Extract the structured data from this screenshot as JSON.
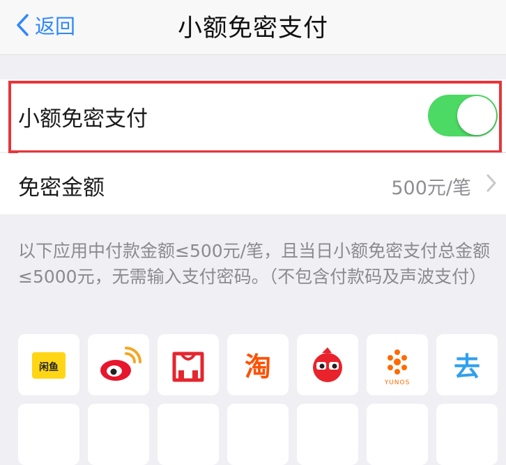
{
  "nav": {
    "back_label": "返回",
    "title": "小额免密支付"
  },
  "toggle_row": {
    "label": "小额免密支付",
    "enabled": true
  },
  "amount_row": {
    "label": "免密金额",
    "value": "500元/笔"
  },
  "description": "以下应用中付款金额≤500元/笔，且当日小额免密支付总金额≤5000元，无需输入支付密码。（不包含付款码及声波支付）",
  "apps": [
    {
      "icon": "xianyu-icon",
      "text": "闲鱼"
    },
    {
      "icon": "weibo-icon"
    },
    {
      "icon": "tmall-icon"
    },
    {
      "icon": "taobao-icon",
      "text": "淘"
    },
    {
      "icon": "red-bird-icon"
    },
    {
      "icon": "yunos-icon",
      "text": "YUNOS"
    },
    {
      "icon": "qunar-icon",
      "text": "去"
    }
  ],
  "colors": {
    "accent": "#2f88ff",
    "switch_on": "#4cd964",
    "highlight": "#e8343a",
    "background": "#efeff4"
  }
}
